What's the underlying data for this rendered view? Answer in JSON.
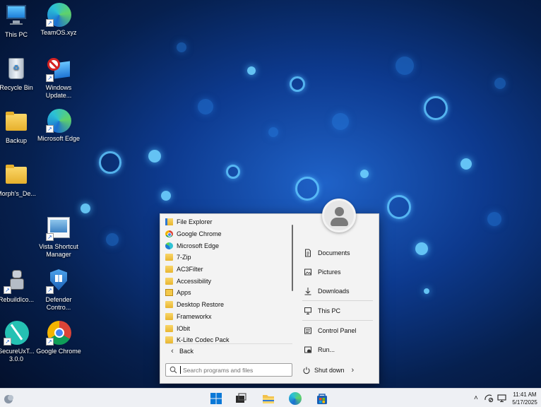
{
  "desktop": {
    "icons": [
      {
        "label": "This PC"
      },
      {
        "label": "TeamOS.xyz"
      },
      {
        "label": "Recycle Bin"
      },
      {
        "label": "Windows Update..."
      },
      {
        "label": "Backup"
      },
      {
        "label": "Microsoft Edge"
      },
      {
        "label": "Morph's_De..."
      },
      {
        "label": "Vista Shortcut Manager"
      },
      {
        "label": "RebuildIco..."
      },
      {
        "label": "Defender Contro..."
      },
      {
        "label": "SecureUxT... 3.0.0"
      },
      {
        "label": "Google Chrome"
      }
    ]
  },
  "start_menu": {
    "programs": [
      {
        "label": "File Explorer",
        "icon": "file-explorer-icon"
      },
      {
        "label": "Google Chrome",
        "icon": "chrome-icon"
      },
      {
        "label": "Microsoft Edge",
        "icon": "edge-icon"
      },
      {
        "label": "7-Zip",
        "icon": "folder-icon"
      },
      {
        "label": "AC3Filter",
        "icon": "folder-icon"
      },
      {
        "label": "Accessibility",
        "icon": "folder-icon"
      },
      {
        "label": "Apps",
        "icon": "apps-icon"
      },
      {
        "label": "Desktop Restore",
        "icon": "folder-icon"
      },
      {
        "label": "Frameworkx",
        "icon": "folder-icon"
      },
      {
        "label": "IObit",
        "icon": "folder-icon"
      },
      {
        "label": "K-Lite Codec Pack",
        "icon": "folder-icon"
      }
    ],
    "back_label": "Back",
    "right_items": [
      {
        "label": "Documents",
        "icon": "document-icon"
      },
      {
        "label": "Pictures",
        "icon": "pictures-icon"
      },
      {
        "label": "Downloads",
        "icon": "download-icon"
      },
      {
        "label": "This PC",
        "icon": "computer-icon"
      },
      {
        "label": "Control Panel",
        "icon": "control-panel-icon"
      },
      {
        "label": "Run...",
        "icon": "run-icon"
      }
    ],
    "search_placeholder": "Search programs and files",
    "shutdown_label": "Shut down"
  },
  "taskbar": {
    "clock_time": "11:41 AM",
    "clock_date": "5/17/2025"
  },
  "colors": {
    "accent": "#0067c0",
    "taskbar_bg": "#eef0f4",
    "start_bg": "#f3f3f3"
  }
}
